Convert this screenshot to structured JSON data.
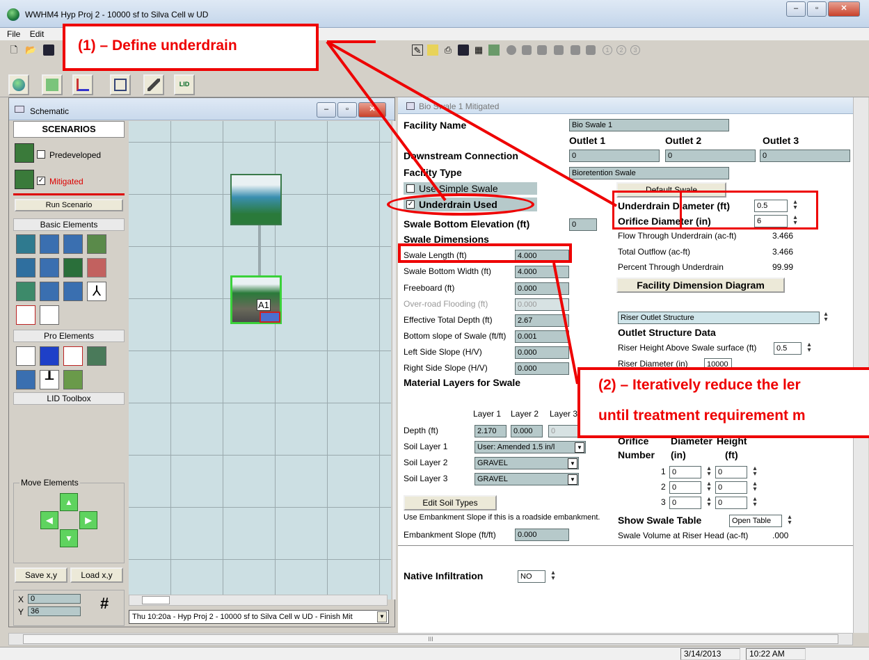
{
  "window": {
    "title": "WWHM4  Hyp Proj 2 - 10000 sf to Silva Cell w UD"
  },
  "menu": [
    "File",
    "Edit"
  ],
  "annotations": {
    "define_underdrain": "(1) – Define underdrain",
    "reduce_line1": "(2) –  Iteratively reduce the ler",
    "reduce_line2": "until treatment requirement m"
  },
  "schematic": {
    "title": "Schematic",
    "scenarios_header": "SCENARIOS",
    "predeveloped": "Predeveloped",
    "mitigated": "Mitigated",
    "run_scenario": "Run Scenario",
    "basic_elements": "Basic Elements",
    "pro_elements": "Pro Elements",
    "lid_toolbox": "LID Toolbox",
    "move_elements": "Move Elements",
    "save_xy": "Save x,y",
    "load_xy": "Load x,y",
    "x_label": "X",
    "x_value": "0",
    "y_label": "Y",
    "y_value": "36",
    "hash": "#",
    "node_label": "A1",
    "status_line": "Thu 10:20a - Hyp Proj 2 - 10000 sf to Silva Cell w UD - Finish Mit"
  },
  "facility": {
    "panel_title": "Bio Swale 1 Mitigated",
    "facility_name_label": "Facility Name",
    "facility_name": "Bio Swale 1",
    "outlet1": "Outlet 1",
    "outlet2": "Outlet 2",
    "outlet3": "Outlet 3",
    "downstream_label": "Downstream Connection",
    "downstream_values": [
      "0",
      "0",
      "0"
    ],
    "facility_type_label": "Facility Type",
    "facility_type": "Bioretention Swale",
    "use_simple_swale": "Use Simple Swale",
    "default_swale": "Default Swale",
    "underdrain_used": "Underdrain Used",
    "underdrain_diameter_label": "Underdrain Diameter (ft)",
    "underdrain_diameter": "0.5",
    "orifice_diameter_label": "Orifice Diameter (in)",
    "orifice_diameter": "6",
    "swale_bottom_elev_label": "Swale Bottom Elevation (ft)",
    "swale_bottom_elev": "0",
    "swale_dimensions": "Swale Dimensions",
    "flow_through_label": "Flow Through Underdrain (ac-ft)",
    "flow_through": "3.466",
    "total_outflow_label": "Total Outflow (ac-ft)",
    "total_outflow": "3.466",
    "percent_through_label": "Percent Through Underdrain",
    "percent_through": "99.99",
    "diagram_button": "Facility Dimension Diagram",
    "dims": [
      {
        "label": "Swale Length (ft)",
        "value": "4.000"
      },
      {
        "label": "Swale Bottom Width (ft)",
        "value": "4.000"
      },
      {
        "label": "Freeboard (ft)",
        "value": "0.000"
      },
      {
        "label": "Over-road Flooding (ft)",
        "value": "0.000"
      },
      {
        "label": "Effective Total Depth (ft)",
        "value": "2.67"
      },
      {
        "label": "Bottom slope of Swale (ft/ft)",
        "value": "0.001"
      },
      {
        "label": "Left Side Slope (H/V)",
        "value": "0.000"
      },
      {
        "label": "Right Side Slope (H/V)",
        "value": "0.000"
      }
    ],
    "riser_outlet": "Riser Outlet Structure",
    "outlet_structure_data": "Outlet Structure Data",
    "riser_height_label": "Riser Height Above Swale surface (ft)",
    "riser_height": "0.5",
    "riser_diameter_label": "Riser Diameter (in)",
    "riser_diameter": "10000",
    "material_layers": "Material Layers for Swale",
    "layer1": "Layer 1",
    "layer2": "Layer 2",
    "layer3": "Layer 3",
    "depth_label": "Depth (ft)",
    "depths": [
      "2.170",
      "0.000",
      "0"
    ],
    "soil1_label": "Soil Layer 1",
    "soil1": "User: Amended 1.5 in/l",
    "soil2_label": "Soil Layer 2",
    "soil2": "GRAVEL",
    "soil3_label": "Soil Layer 3",
    "soil3": "GRAVEL",
    "orifice_number": "Orifice",
    "orifice_number2": "Number",
    "diameter_head": "Diameter",
    "diameter_unit": "(in)",
    "height_head": "Height",
    "height_unit": "(ft)",
    "orifices": [
      {
        "n": "1",
        "d": "0",
        "h": "0"
      },
      {
        "n": "2",
        "d": "0",
        "h": "0"
      },
      {
        "n": "3",
        "d": "0",
        "h": "0"
      }
    ],
    "edit_soil": "Edit Soil Types",
    "embankment_note": "Use Embankment Slope if this is a roadside embankment.",
    "embankment_label": "Embankment Slope (ft/ft)",
    "embankment": "0.000",
    "show_swale_table": "Show Swale Table",
    "open_table": "Open Table",
    "swale_volume_label": "Swale Volume at Riser Head (ac-ft)",
    "swale_volume": ".000",
    "native_infiltration": "Native Infiltration",
    "native_value": "NO"
  },
  "status": {
    "date": "3/14/2013",
    "time": "10:22 AM",
    "scroll_mark": "III"
  }
}
